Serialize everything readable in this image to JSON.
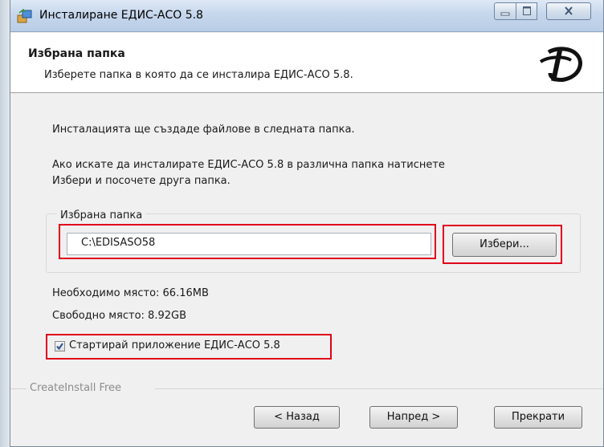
{
  "window": {
    "title": "Инсталиране ЕДИС-АСО 5.8"
  },
  "header": {
    "title": "Избрана папка",
    "subtitle": "Изберете папка в която да се инсталира ЕДИС-АСО 5.8."
  },
  "body": {
    "intro": "Инсталацията ще създаде файлове в следната папка.",
    "instruction_line1": "Ако искате да инсталирате ЕДИС-АСО 5.8 в различна папка натиснете",
    "instruction_line2": "Избери и посочете друга папка.",
    "folder_group_label": "Избрана папка",
    "folder_path": "C:\\EDISASO58",
    "browse_label": "Избери...",
    "required_space": "Необходимо място: 66.16MB",
    "free_space": "Свободно място: 8.92GB",
    "launch_checkbox": {
      "label": "Стартирай приложение ЕДИС-АСО 5.8",
      "checked": true
    }
  },
  "footer": {
    "brand": "CreateInstall Free",
    "back_label": "< Назад",
    "next_label": "Напред >",
    "cancel_label": "Прекрати"
  },
  "colors": {
    "highlight": "#e0001a",
    "titlebar": "#c6d7ec",
    "dialog_bg": "#f0f0f0"
  },
  "icons": [
    "installer-app-icon",
    "minimize-icon",
    "maximize-icon",
    "close-icon",
    "edis-logo",
    "checkmark-icon"
  ]
}
